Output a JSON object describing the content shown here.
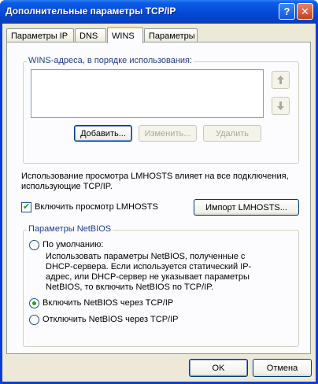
{
  "window": {
    "title": "Дополнительные параметры TCP/IP",
    "help_glyph": "?",
    "close_glyph": "✕"
  },
  "tabs": [
    {
      "label": "Параметры IP",
      "active": false
    },
    {
      "label": "DNS",
      "active": false
    },
    {
      "label": "WINS",
      "active": true
    },
    {
      "label": "Параметры",
      "active": false
    }
  ],
  "wins": {
    "group_label": "WINS-адреса, в порядке использования:",
    "addresses": [],
    "add_label": "Добавить...",
    "edit_label": "Изменить...",
    "remove_label": "Удалить",
    "move_up_icon": "arrow-up",
    "move_down_icon": "arrow-down"
  },
  "lmhosts": {
    "description": "Использование просмотра LMHOSTS влияет на все подключения, использующие TCP/IP.",
    "checkbox_label": "Включить просмотр LMHOSTS",
    "checked": true,
    "import_label": "Импорт LMHOSTS..."
  },
  "netbios": {
    "group_label": "Параметры NetBIOS",
    "options": [
      {
        "label": "По умолчанию:",
        "selected": false
      },
      {
        "label": "Включить NetBIOS через TCP/IP",
        "selected": true
      },
      {
        "label": "Отключить NetBIOS через TCP/IP",
        "selected": false
      }
    ],
    "default_description": "Использовать параметры NetBIOS, полученные с DHCP-сервера. Если используется статический IP-адрес, или DHCP-сервер не указывает параметры NetBIOS, то включить NetBIOS по TCP/IP."
  },
  "footer": {
    "ok_label": "OK",
    "cancel_label": "Отмена"
  },
  "colors": {
    "titlebar": "#0548d4",
    "client_bg": "#ece9d8",
    "active_tab_accent": "#fbbc3c",
    "check_green": "#21a121"
  }
}
